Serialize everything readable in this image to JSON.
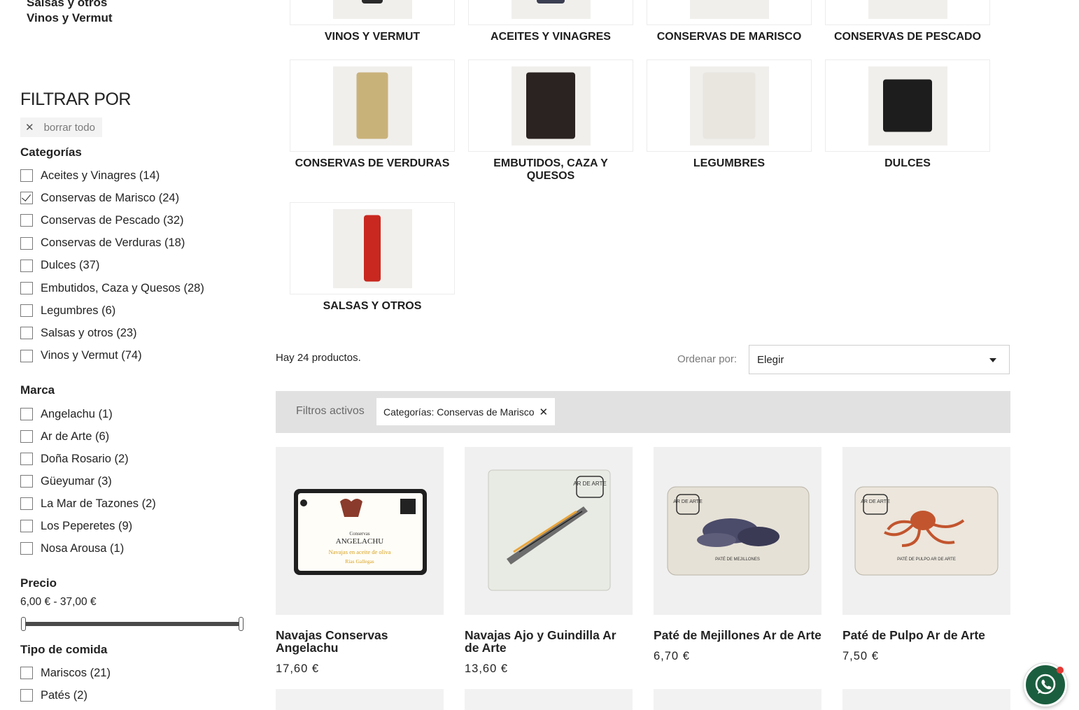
{
  "sidebar": {
    "category_links": [
      "Salsas y otros",
      "Vinos y Vermut"
    ],
    "filter_title": "FILTRAR POR",
    "clear_all": "borrar todo",
    "categories_title": "Categorías",
    "categories": [
      {
        "label": "Aceites y Vinagres (14)",
        "checked": false
      },
      {
        "label": "Conservas de Marisco (24)",
        "checked": true
      },
      {
        "label": "Conservas de Pescado (32)",
        "checked": false
      },
      {
        "label": "Conservas de Verduras (18)",
        "checked": false
      },
      {
        "label": "Dulces (37)",
        "checked": false
      },
      {
        "label": "Embutidos, Caza y Quesos (28)",
        "checked": false
      },
      {
        "label": "Legumbres (6)",
        "checked": false
      },
      {
        "label": "Salsas y otros (23)",
        "checked": false
      },
      {
        "label": "Vinos y Vermut (74)",
        "checked": false
      }
    ],
    "brand_title": "Marca",
    "brands": [
      {
        "label": "Angelachu (1)"
      },
      {
        "label": "Ar de Arte (6)"
      },
      {
        "label": "Doña Rosario (2)"
      },
      {
        "label": "Güeyumar (3)"
      },
      {
        "label": "La Mar de Tazones (2)"
      },
      {
        "label": "Los Peperetes (9)"
      },
      {
        "label": "Nosa Arousa (1)"
      }
    ],
    "price_title": "Precio",
    "price_range": "6,00 € - 37,00 €",
    "price_min": 6.0,
    "price_max": 37.0,
    "food_type_title": "Tipo de comida",
    "food_types": [
      {
        "label": "Mariscos (21)"
      },
      {
        "label": "Patés (2)"
      }
    ]
  },
  "subcategories": [
    {
      "name": "VINOS Y VERMUT"
    },
    {
      "name": "ACEITES Y VINAGRES"
    },
    {
      "name": "CONSERVAS DE MARISCO"
    },
    {
      "name": "CONSERVAS DE PESCADO"
    },
    {
      "name": "CONSERVAS DE VERDURAS"
    },
    {
      "name": "EMBUTIDOS, CAZA Y QUESOS"
    },
    {
      "name": "LEGUMBRES"
    },
    {
      "name": "DULCES"
    },
    {
      "name": "SALSAS Y OTROS"
    }
  ],
  "toolbar": {
    "product_count": "Hay 24 productos.",
    "sort_label": "Ordenar por:",
    "sort_value": "Elegir"
  },
  "active_filters": {
    "label": "Filtros activos",
    "chips": [
      "Categorías: Conservas de Marisco"
    ]
  },
  "products": [
    {
      "title": "Navajas Conservas Angelachu",
      "price": "17,60 €",
      "image_text": [
        "Conservas",
        "ANGELACHU",
        "Navajas en aceite de oliva",
        "Rías Gallegas"
      ]
    },
    {
      "title": "Navajas Ajo y Guindilla Ar de Arte",
      "price": "13,60 €",
      "image_text": [
        "AR DE ARTE"
      ]
    },
    {
      "title": "Paté de Mejillones Ar de Arte",
      "price": "6,70 €",
      "image_text": [
        "AR DE ARTE",
        "PATÉ DE MEJILLONES"
      ]
    },
    {
      "title": "Paté de Pulpo Ar de Arte",
      "price": "7,50 €",
      "image_text": [
        "AR DE ARTE",
        "PATÉ DE PULPO AR DE ARTE"
      ]
    }
  ],
  "whatsapp": {
    "icon": "whatsapp-icon",
    "color": "#1b5e3f"
  }
}
